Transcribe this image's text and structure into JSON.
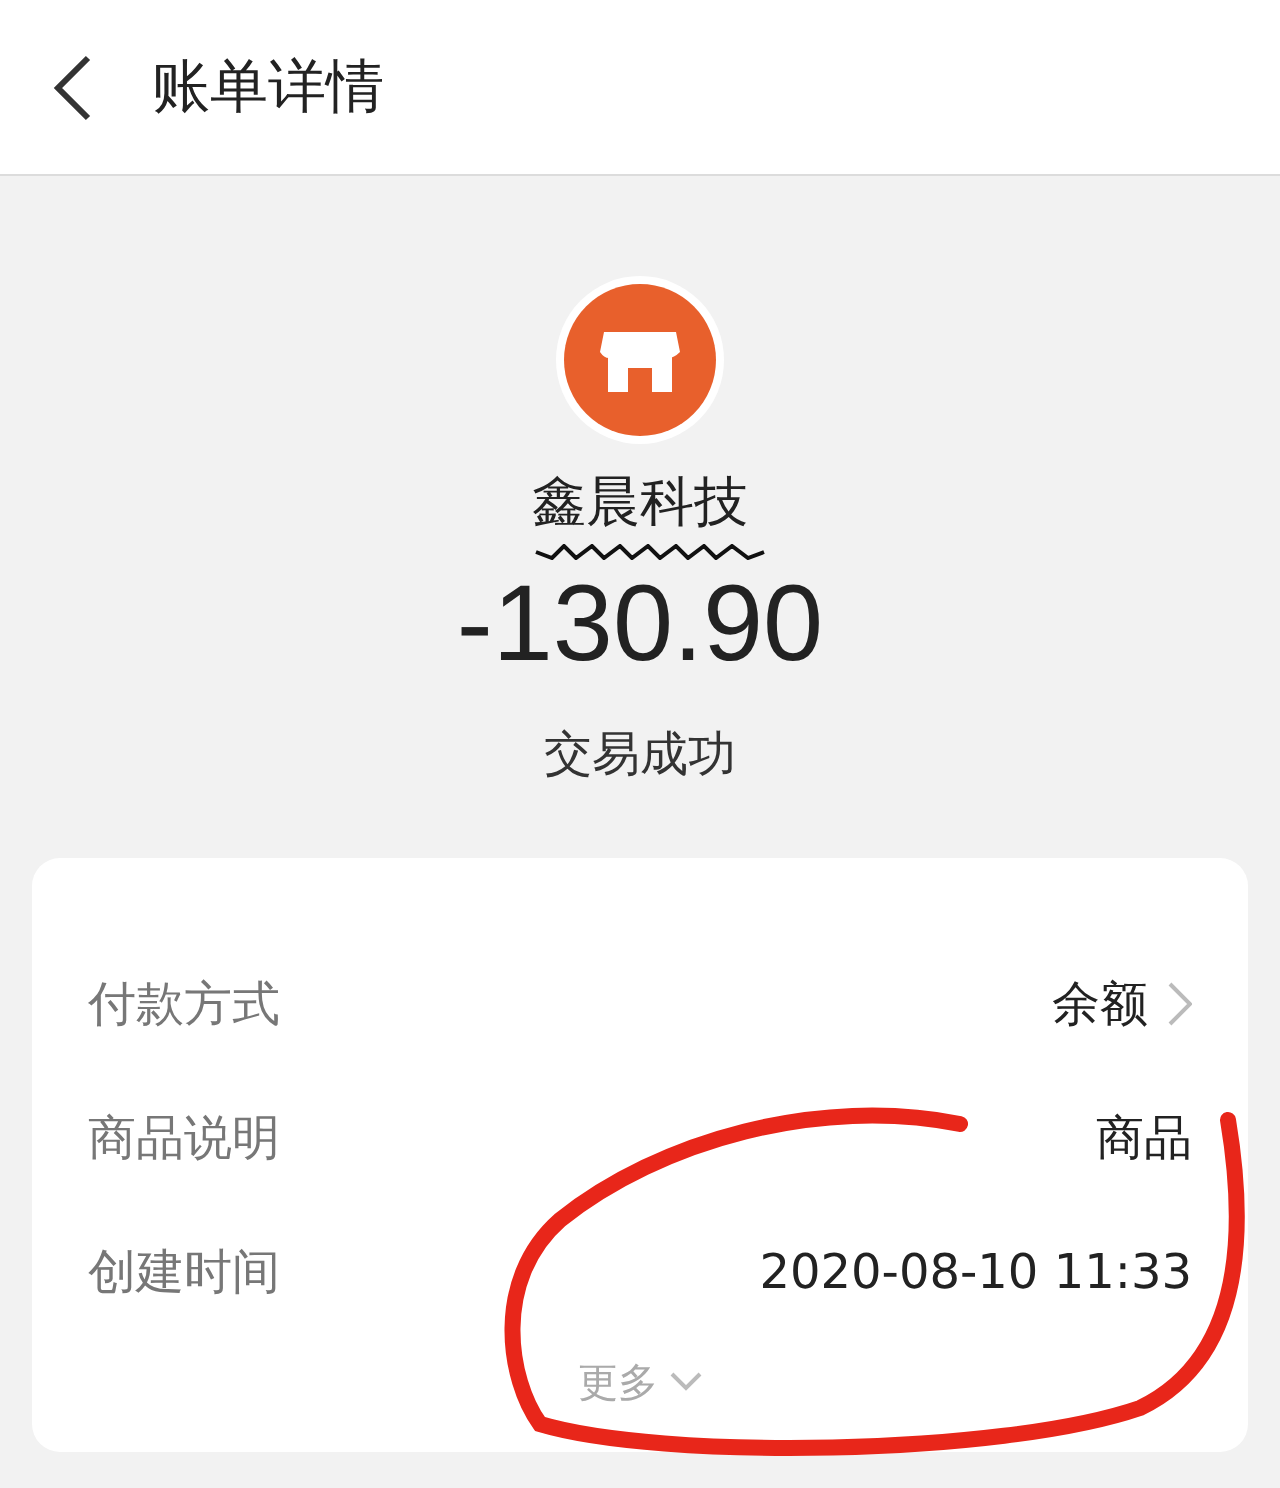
{
  "header": {
    "title": "账单详情"
  },
  "merchant": {
    "name": "鑫晨科技",
    "amount": "-130.90",
    "status": "交易成功"
  },
  "details": [
    {
      "label": "付款方式",
      "value": "余额",
      "has_arrow": true
    },
    {
      "label": "商品说明",
      "value": "商品",
      "has_arrow": false
    },
    {
      "label": "创建时间",
      "value": "2020-08-10 11:33",
      "has_arrow": false
    }
  ],
  "more": {
    "label": "更多",
    "expanded": false
  }
}
